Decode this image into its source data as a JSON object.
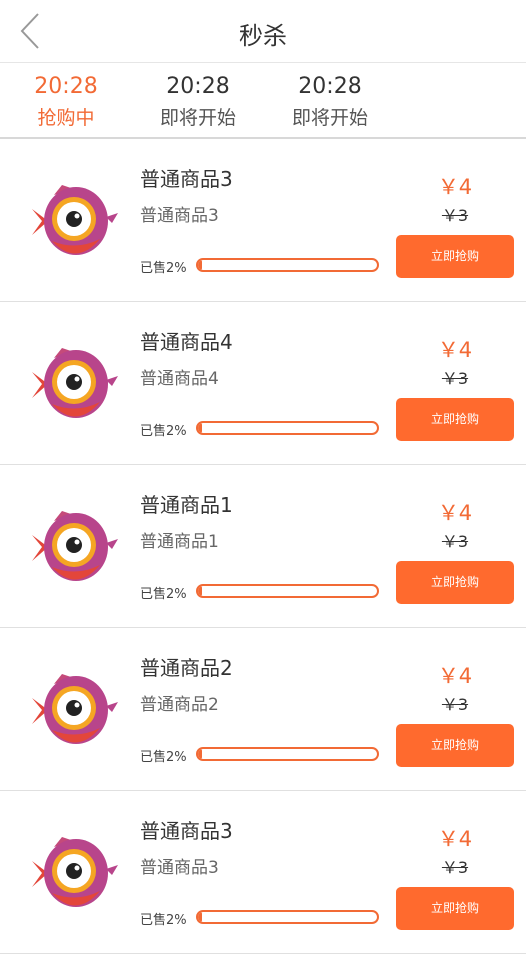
{
  "header": {
    "title": "秒杀"
  },
  "tabs": [
    {
      "time": "20:28",
      "status": "抢购中"
    },
    {
      "time": "20:28",
      "status": "即将开始"
    },
    {
      "time": "20:28",
      "status": "即将开始"
    }
  ],
  "colors": {
    "accent": "#f26a35",
    "button": "#ff6a2e"
  },
  "products": [
    {
      "name": "普通商品3",
      "subtitle": "普通商品3",
      "sold_label": "已售2%",
      "progress": 0.02,
      "price": "￥4",
      "original_price": "￥3",
      "buy_label": "立即抢购",
      "thumb_icon": "fish-mascot-icon"
    },
    {
      "name": "普通商品4",
      "subtitle": "普通商品4",
      "sold_label": "已售2%",
      "progress": 0.02,
      "price": "￥4",
      "original_price": "￥3",
      "buy_label": "立即抢购",
      "thumb_icon": "fish-mascot-icon"
    },
    {
      "name": "普通商品1",
      "subtitle": "普通商品1",
      "sold_label": "已售2%",
      "progress": 0.02,
      "price": "￥4",
      "original_price": "￥3",
      "buy_label": "立即抢购",
      "thumb_icon": "fish-mascot-icon"
    },
    {
      "name": "普通商品2",
      "subtitle": "普通商品2",
      "sold_label": "已售2%",
      "progress": 0.02,
      "price": "￥4",
      "original_price": "￥3",
      "buy_label": "立即抢购",
      "thumb_icon": "fish-mascot-icon"
    },
    {
      "name": "普通商品3",
      "subtitle": "普通商品3",
      "sold_label": "已售2%",
      "progress": 0.02,
      "price": "￥4",
      "original_price": "￥3",
      "buy_label": "立即抢购",
      "thumb_icon": "fish-mascot-icon"
    }
  ]
}
